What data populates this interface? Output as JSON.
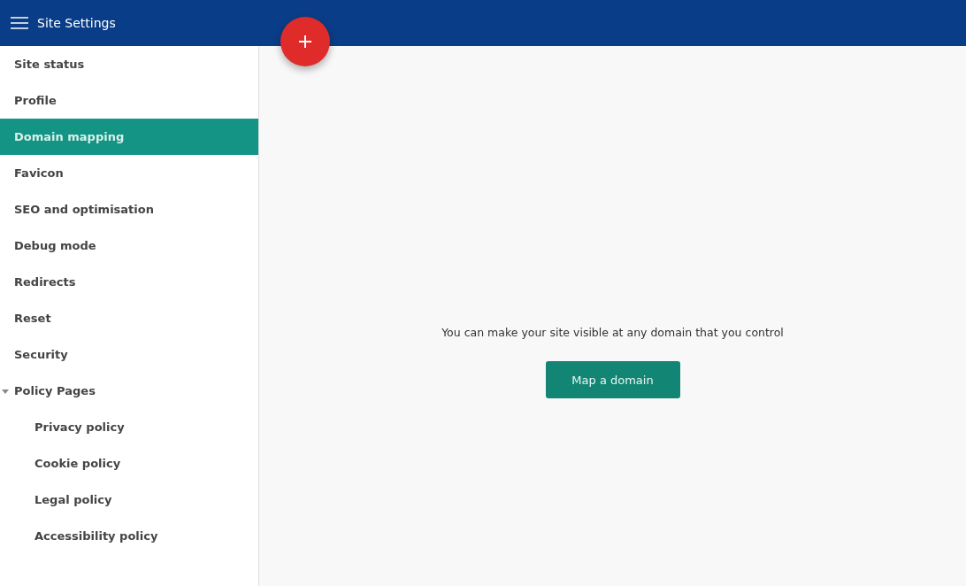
{
  "header": {
    "title": "Site Settings"
  },
  "sidebar": {
    "items": [
      {
        "label": "Site status",
        "selected": false
      },
      {
        "label": "Profile",
        "selected": false
      },
      {
        "label": "Domain mapping",
        "selected": true
      },
      {
        "label": "Favicon",
        "selected": false
      },
      {
        "label": "SEO and optimisation",
        "selected": false
      },
      {
        "label": "Debug mode",
        "selected": false
      },
      {
        "label": "Redirects",
        "selected": false
      },
      {
        "label": "Reset",
        "selected": false
      },
      {
        "label": "Security",
        "selected": false
      },
      {
        "label": "Policy Pages",
        "selected": false,
        "expanded": true,
        "children": [
          {
            "label": "Privacy policy",
            "selected": false
          },
          {
            "label": "Cookie policy",
            "selected": false
          },
          {
            "label": "Legal policy",
            "selected": false
          },
          {
            "label": "Accessibility policy",
            "selected": false
          }
        ]
      }
    ]
  },
  "main": {
    "message": "You can make your site visible at any domain that you control",
    "button": "Map a domain"
  }
}
